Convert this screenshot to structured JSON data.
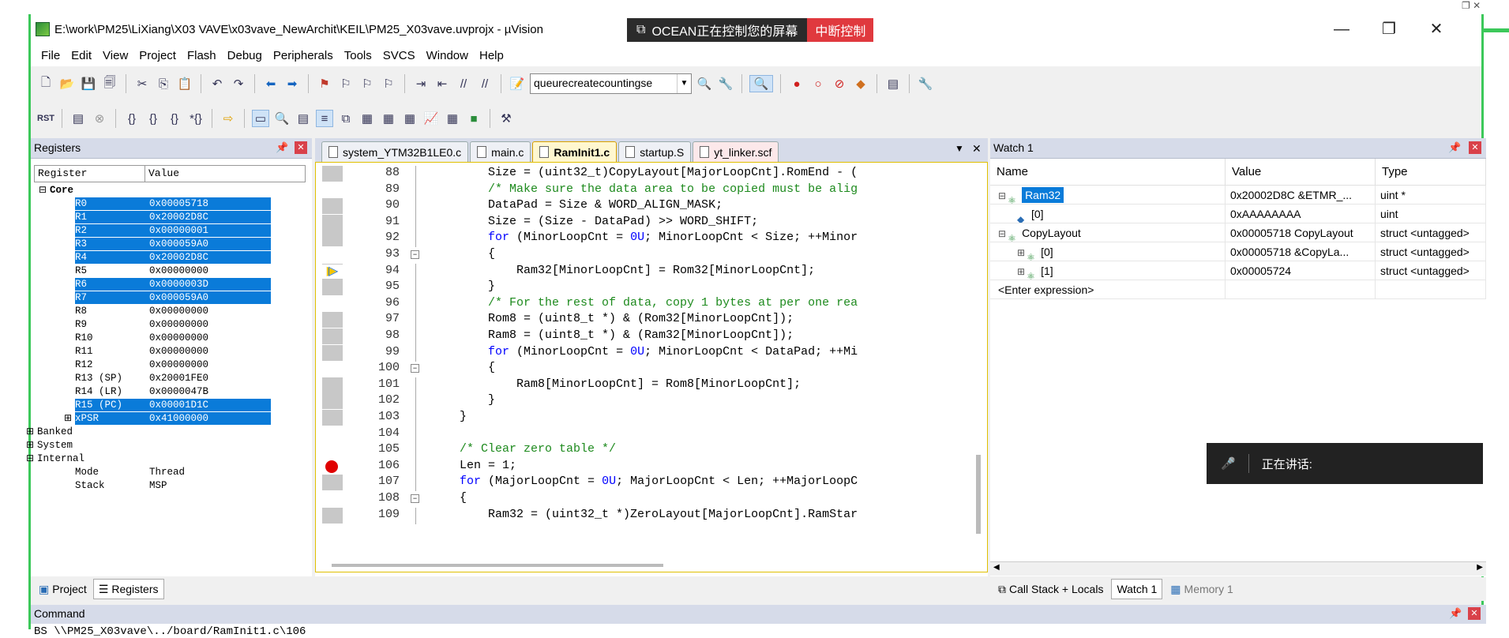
{
  "window": {
    "title": "E:\\work\\PM25\\LiXiang\\X03 VAVE\\x03vave_NewArchit\\KEIL\\PM25_X03vave.uvprojx - µVision",
    "min": "—",
    "restore": "❐",
    "close": "✕"
  },
  "remote": {
    "text": "OCEAN正在控制您的屏幕",
    "button": "中断控制"
  },
  "menu": [
    "File",
    "Edit",
    "View",
    "Project",
    "Flash",
    "Debug",
    "Peripherals",
    "Tools",
    "SVCS",
    "Window",
    "Help"
  ],
  "toolbar": {
    "combo_value": "queurecreatecountingse"
  },
  "registers": {
    "title": "Registers",
    "col_register": "Register",
    "col_value": "Value",
    "rows": [
      {
        "name": "Core",
        "value": "",
        "indent": 1,
        "bold": true,
        "expander": "⊟",
        "sel": false
      },
      {
        "name": "R0",
        "value": "0x00005718",
        "indent": 3,
        "sel": true
      },
      {
        "name": "R1",
        "value": "0x20002D8C",
        "indent": 3,
        "sel": true
      },
      {
        "name": "R2",
        "value": "0x00000001",
        "indent": 3,
        "sel": true
      },
      {
        "name": "R3",
        "value": "0x000059A0",
        "indent": 3,
        "sel": true
      },
      {
        "name": "R4",
        "value": "0x20002D8C",
        "indent": 3,
        "sel": true
      },
      {
        "name": "R5",
        "value": "0x00000000",
        "indent": 3,
        "sel": false
      },
      {
        "name": "R6",
        "value": "0x0000003D",
        "indent": 3,
        "sel": true
      },
      {
        "name": "R7",
        "value": "0x000059A0",
        "indent": 3,
        "sel": true
      },
      {
        "name": "R8",
        "value": "0x00000000",
        "indent": 3,
        "sel": false
      },
      {
        "name": "R9",
        "value": "0x00000000",
        "indent": 3,
        "sel": false
      },
      {
        "name": "R10",
        "value": "0x00000000",
        "indent": 3,
        "sel": false
      },
      {
        "name": "R11",
        "value": "0x00000000",
        "indent": 3,
        "sel": false
      },
      {
        "name": "R12",
        "value": "0x00000000",
        "indent": 3,
        "sel": false
      },
      {
        "name": "R13 (SP)",
        "value": "0x20001FE0",
        "indent": 3,
        "sel": false
      },
      {
        "name": "R14 (LR)",
        "value": "0x0000047B",
        "indent": 3,
        "sel": false
      },
      {
        "name": "R15 (PC)",
        "value": "0x00001D1C",
        "indent": 3,
        "sel": true
      },
      {
        "name": "xPSR",
        "value": "0x41000000",
        "indent": 3,
        "expander": "⊞",
        "sel": true
      },
      {
        "name": "Banked",
        "value": "",
        "indent": 0,
        "expander": "⊞",
        "sel": false
      },
      {
        "name": "System",
        "value": "",
        "indent": 0,
        "expander": "⊞",
        "sel": false
      },
      {
        "name": "Internal",
        "value": "",
        "indent": 0,
        "expander": "⊟",
        "sel": false
      },
      {
        "name": "Mode",
        "value": "Thread",
        "indent": 3,
        "sel": false
      },
      {
        "name": "Stack",
        "value": "MSP",
        "indent": 3,
        "sel": false
      }
    ],
    "tab_project": "Project",
    "tab_registers": "Registers"
  },
  "editor": {
    "tabs": [
      {
        "label": "system_YTM32B1LE0.c",
        "active": false,
        "pink": false
      },
      {
        "label": "main.c",
        "active": false,
        "pink": false
      },
      {
        "label": "RamInit1.c",
        "active": true,
        "pink": false
      },
      {
        "label": "startup.S",
        "active": false,
        "pink": false
      },
      {
        "label": "yt_linker.scf",
        "active": false,
        "pink": true
      }
    ],
    "tab_menu": "▼",
    "tab_close": "✕",
    "lines": [
      {
        "n": "88",
        "code": "            Size = (uint32_t)CopyLayout[MajorLoopCnt].RomEnd - (",
        "gray": true
      },
      {
        "n": "89",
        "code": "            /* Make sure the data area to be copied must be alig",
        "cm": true
      },
      {
        "n": "90",
        "code": "            DataPad = Size & WORD_ALIGN_MASK;",
        "gray": true
      },
      {
        "n": "91",
        "code": "            Size = (Size - DataPad) >> WORD_SHIFT;",
        "gray": true
      },
      {
        "n": "92",
        "code": "            for (MinorLoopCnt = 0U; MinorLoopCnt < Size; ++Minor",
        "gray": true
      },
      {
        "n": "93",
        "code": "            {",
        "fold": true
      },
      {
        "n": "94",
        "code": "                Ram32[MinorLoopCnt] = Rom32[MinorLoopCnt];",
        "arrow": true
      },
      {
        "n": "95",
        "code": "            }",
        "gray": true
      },
      {
        "n": "96",
        "code": "            /* For the rest of data, copy 1 bytes at per one rea",
        "cm": true
      },
      {
        "n": "97",
        "code": "            Rom8 = (uint8_t *) & (Rom32[MinorLoopCnt]);",
        "gray": true
      },
      {
        "n": "98",
        "code": "            Ram8 = (uint8_t *) & (Ram32[MinorLoopCnt]);",
        "gray": true
      },
      {
        "n": "99",
        "code": "            for (MinorLoopCnt = 0U; MinorLoopCnt < DataPad; ++Mi",
        "gray": true
      },
      {
        "n": "100",
        "code": "            {",
        "fold": true
      },
      {
        "n": "101",
        "code": "                Ram8[MinorLoopCnt] = Rom8[MinorLoopCnt];",
        "gray": true
      },
      {
        "n": "102",
        "code": "            }",
        "gray": true
      },
      {
        "n": "103",
        "code": "        }",
        "gray": true
      },
      {
        "n": "104",
        "code": ""
      },
      {
        "n": "105",
        "code": "        /* Clear zero table */",
        "cm": true
      },
      {
        "n": "106",
        "code": "        Len = 1;",
        "bp": true
      },
      {
        "n": "107",
        "code": "        for (MajorLoopCnt = 0U; MajorLoopCnt < Len; ++MajorLoopC",
        "gray": true
      },
      {
        "n": "108",
        "code": "        {",
        "fold": true
      },
      {
        "n": "109",
        "code": "            Ram32 = (uint32_t *)ZeroLayout[MajorLoopCnt].RamStar",
        "gray": true
      }
    ]
  },
  "watch": {
    "title": "Watch 1",
    "col_name": "Name",
    "col_value": "Value",
    "col_type": "Type",
    "rows": [
      {
        "name": "Ram32",
        "value": "0x20002D8C &ETMR_...",
        "type": "uint *",
        "level": 1,
        "exp": "⊟",
        "sel": true
      },
      {
        "name": "[0]",
        "value": "0xAAAAAAAA",
        "type": "uint",
        "level": 2,
        "exp": "",
        "sel": false
      },
      {
        "name": "CopyLayout",
        "value": "0x00005718 CopyLayout",
        "type": "struct <untagged>",
        "level": 1,
        "exp": "⊟",
        "sel": false
      },
      {
        "name": "[0]",
        "value": "0x00005718 &CopyLa...",
        "type": "struct <untagged>",
        "level": 2,
        "exp": "⊞",
        "sel": false
      },
      {
        "name": "[1]",
        "value": "0x00005724",
        "type": "struct <untagged>",
        "level": 2,
        "exp": "⊞",
        "sel": false
      },
      {
        "name": "<Enter expression>",
        "value": "",
        "type": "",
        "level": 1,
        "exp": "",
        "sel": false
      }
    ],
    "tab_callstack": "Call Stack + Locals",
    "tab_watch": "Watch 1",
    "tab_memory": "Memory 1"
  },
  "talk": {
    "text": "正在讲话:"
  },
  "command": {
    "title": "Command",
    "line": "BS \\\\PM25_X03vave\\../board/RamInit1.c\\106"
  }
}
